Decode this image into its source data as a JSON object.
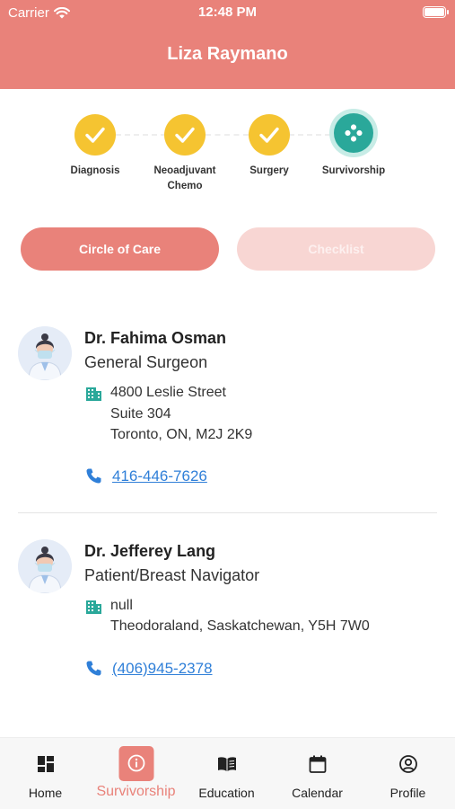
{
  "status_bar": {
    "carrier": "Carrier",
    "time": "12:48 PM"
  },
  "header": {
    "title": "Liza Raymano",
    "color": "#e9827a"
  },
  "stepper": {
    "steps": [
      {
        "label": "Diagnosis",
        "state": "complete",
        "icon": "check-icon"
      },
      {
        "label": "Neoadjuvant Chemo",
        "state": "complete",
        "icon": "check-icon"
      },
      {
        "label": "Surgery",
        "state": "complete",
        "icon": "check-icon"
      },
      {
        "label": "Survivorship",
        "state": "current",
        "icon": "survivorship-icon"
      }
    ],
    "complete_color": "#f5c431",
    "current_color": "#2aa89a"
  },
  "tabs": {
    "circle_of_care": "Circle of Care",
    "checklist": "Checklist",
    "active": "circle_of_care"
  },
  "doctors": [
    {
      "name": "Dr. Fahima Osman",
      "role": "General Surgeon",
      "address": [
        "4800 Leslie Street",
        "Suite 304",
        "Toronto, ON, M2J 2K9"
      ],
      "phone": "416-446-7626"
    },
    {
      "name": "Dr. Jefferey Lang",
      "role": "Patient/Breast Navigator",
      "address": [
        "null",
        "Theodoraland, Saskatchewan, Y5H 7W0"
      ],
      "phone": "(406)945-2378"
    }
  ],
  "bottom_nav": {
    "items": [
      {
        "label": "Home",
        "icon": "home-grid-icon"
      },
      {
        "label": "Survivorship",
        "icon": "info-icon",
        "active": true
      },
      {
        "label": "Education",
        "icon": "book-icon"
      },
      {
        "label": "Calendar",
        "icon": "calendar-icon"
      },
      {
        "label": "Profile",
        "icon": "profile-icon"
      }
    ]
  },
  "colors": {
    "accent": "#e9827a",
    "link": "#2f7fd8",
    "icon_teal": "#2aa89a"
  }
}
